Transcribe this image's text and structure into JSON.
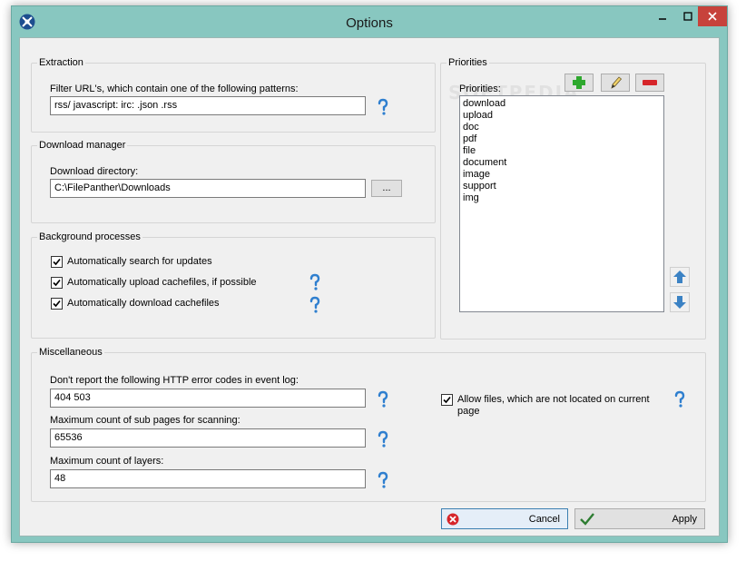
{
  "window": {
    "title": "Options"
  },
  "extraction": {
    "legend": "Extraction",
    "filter_label": "Filter URL's, which contain one of the following patterns:",
    "filter_value": "rss/ javascript: irc: .json .rss"
  },
  "download_manager": {
    "legend": "Download manager",
    "dir_label": "Download directory:",
    "dir_value": "C:\\FilePanther\\Downloads",
    "browse_label": "..."
  },
  "background": {
    "legend": "Background processes",
    "items": [
      {
        "label": "Automatically search for updates",
        "checked": true
      },
      {
        "label": "Automatically upload cachefiles, if possible",
        "checked": true
      },
      {
        "label": "Automatically download cachefiles",
        "checked": true
      }
    ]
  },
  "priorities": {
    "legend": "Priorities",
    "list_label": "Priorities:",
    "items": [
      "download",
      "upload",
      "doc",
      "pdf",
      "file",
      "document",
      "image",
      "support",
      "img"
    ]
  },
  "misc": {
    "legend": "Miscellaneous",
    "http_label": "Don't report the following HTTP error codes in event log:",
    "http_value": "404 503",
    "subpages_label": "Maximum count of sub pages for scanning:",
    "subpages_value": "65536",
    "layers_label": "Maximum count of layers:",
    "layers_value": "48",
    "allow_label_line1": "Allow files, which are not located on current",
    "allow_label_line2": "page",
    "allow_checked": true
  },
  "buttons": {
    "cancel": "Cancel",
    "apply": "Apply"
  },
  "watermark": {
    "text": "SOFTPEDIA"
  },
  "colors": {
    "frame": "#88c7c0",
    "close": "#c7423b",
    "add": "#2ea82e",
    "remove": "#d6252a",
    "arrow": "#3b82c4"
  }
}
